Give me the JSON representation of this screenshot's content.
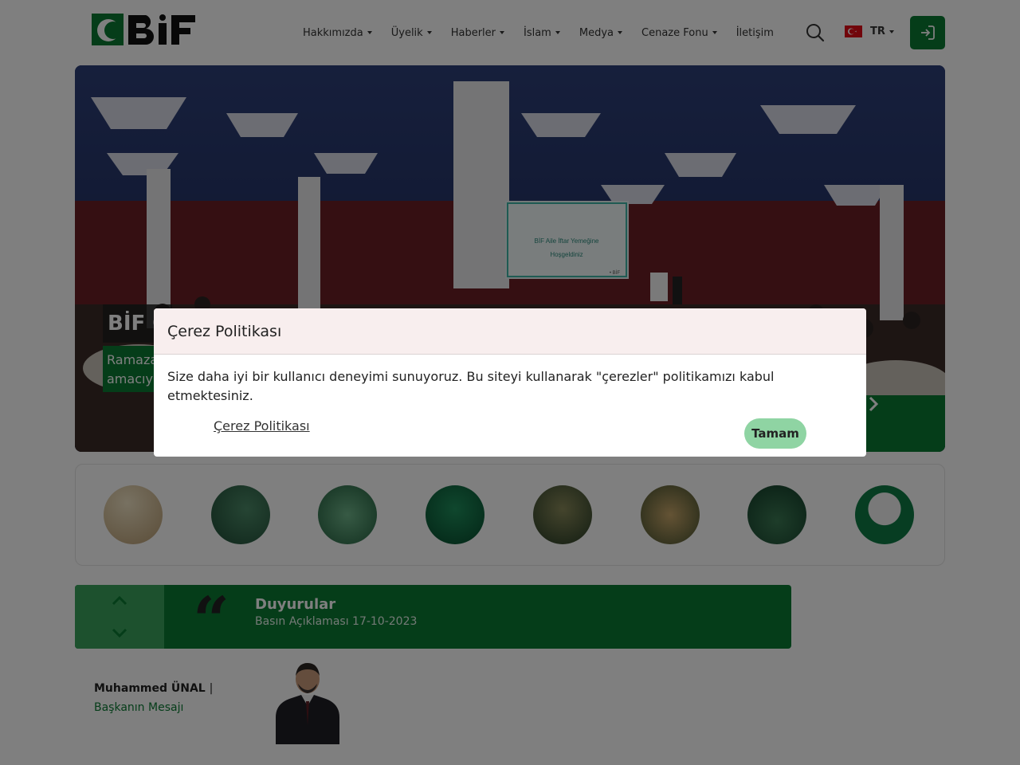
{
  "header": {
    "logo_text": "BİF",
    "nav": [
      {
        "label": "Hakkımızda",
        "dropdown": true
      },
      {
        "label": "Üyelik",
        "dropdown": true
      },
      {
        "label": "Haberler",
        "dropdown": true
      },
      {
        "label": "İslam",
        "dropdown": true
      },
      {
        "label": "Medya",
        "dropdown": true
      },
      {
        "label": "Cenaze Fonu",
        "dropdown": true
      },
      {
        "label": "İletişim",
        "dropdown": false
      }
    ],
    "language": "TR",
    "icons": {
      "search": "search-icon",
      "login": "login-icon",
      "flag": "turkey-flag-icon"
    }
  },
  "hero": {
    "title": "BİF C",
    "description_lines": [
      "Ramaza",
      "amacıyl"
    ],
    "screen_text": [
      "BİF Aile İftar Yemeğine",
      "Hoşgeldiniz",
      "• BİF"
    ],
    "next_icon": "chevron-right-icon"
  },
  "stories": {
    "count": 8,
    "colors": [
      "#d9c7a0",
      "#2f6a4d",
      "#3e8a5e",
      "#0e6b45",
      "#3d5a3a",
      "#8a7a4a",
      "#1f5a3d",
      "#1b7a4a"
    ]
  },
  "announcement": {
    "title": "Duyurular",
    "text": "Basın Açıklaması 17-10-2023",
    "quote": "“",
    "icons": {
      "up": "chevron-up-icon",
      "down": "chevron-down-icon"
    }
  },
  "president": {
    "name": "Muhammed ÜNAL",
    "separator": "|",
    "role": "Başkanın Mesajı"
  },
  "cookie_modal": {
    "title": "Çerez Politikası",
    "text": "Size daha iyi bir kullanıcı deneyimi sunuyoruz. Bu siteyi kullanarak \"çerezler\" politikamızı kabul etmektesiniz.",
    "link_label": "Çerez Politikası",
    "button_label": "Tamam"
  },
  "colors": {
    "brand_green": "#0a7a33",
    "light_green": "#3aa35d",
    "button_green": "#8fd4a3",
    "modal_header": "#f8eeee"
  }
}
